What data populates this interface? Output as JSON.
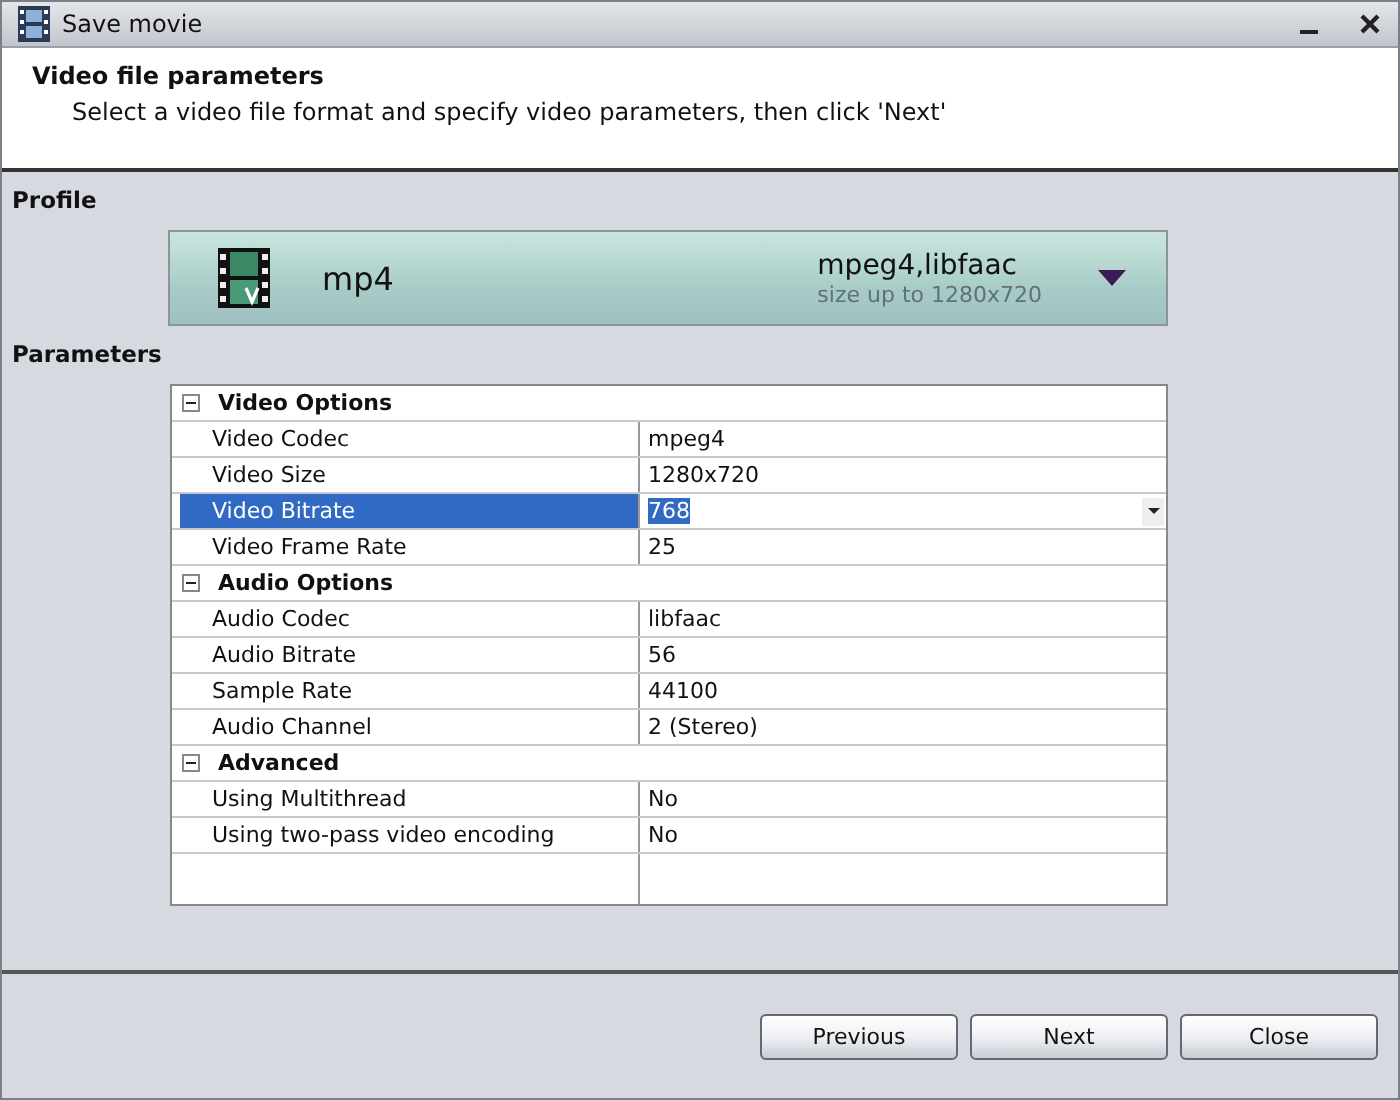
{
  "window": {
    "title": "Save movie"
  },
  "header": {
    "title": "Video file parameters",
    "subtitle": "Select a video file format and specify video parameters, then click 'Next'"
  },
  "profile": {
    "label": "Profile",
    "format": "mp4",
    "codecs": "mpeg4,libfaac",
    "size_note": "size up to 1280x720"
  },
  "parameters": {
    "label": "Parameters",
    "groups": [
      {
        "name": "Video Options",
        "expanded": true,
        "children": [
          {
            "name": "Video Codec",
            "value": "mpeg4",
            "selected": false
          },
          {
            "name": "Video Size",
            "value": "1280x720",
            "selected": false
          },
          {
            "name": "Video Bitrate",
            "value": "768",
            "selected": true
          },
          {
            "name": "Video Frame Rate",
            "value": "25",
            "selected": false
          }
        ]
      },
      {
        "name": "Audio Options",
        "expanded": true,
        "children": [
          {
            "name": "Audio Codec",
            "value": "libfaac",
            "selected": false
          },
          {
            "name": "Audio Bitrate",
            "value": "56",
            "selected": false
          },
          {
            "name": "Sample Rate",
            "value": "44100",
            "selected": false
          },
          {
            "name": "Audio Channel",
            "value": "2 (Stereo)",
            "selected": false
          }
        ]
      },
      {
        "name": "Advanced",
        "expanded": true,
        "children": [
          {
            "name": "Using Multithread",
            "value": "No",
            "selected": false
          },
          {
            "name": "Using two-pass video encoding",
            "value": "No",
            "selected": false
          }
        ]
      }
    ]
  },
  "buttons": [
    "Previous",
    "Next",
    "Close"
  ]
}
